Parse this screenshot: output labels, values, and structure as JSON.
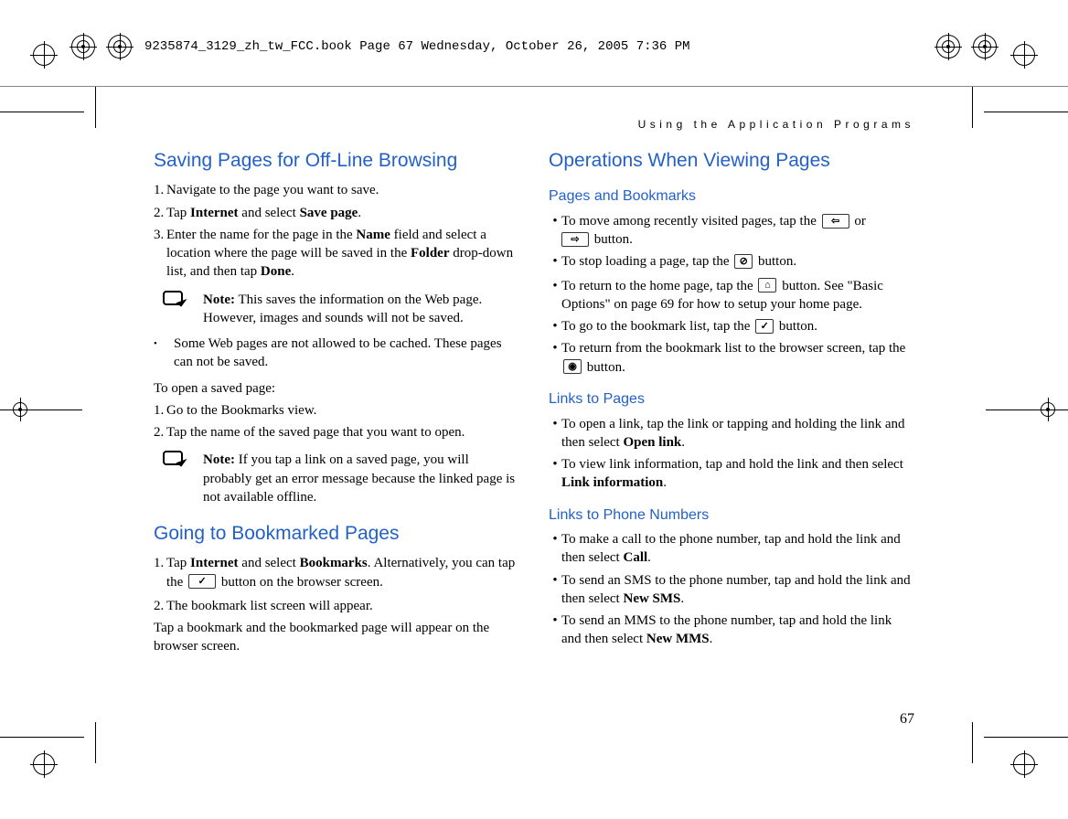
{
  "header_line": "9235874_3129_zh_tw_FCC.book  Page 67  Wednesday, October 26, 2005  7:36 PM",
  "running_head": "Using the Application Programs",
  "page_number": "67",
  "left": {
    "h2_saving": "Saving Pages for Off-Line Browsing",
    "step1": "Navigate to the page you want to save.",
    "step2_a": "Tap ",
    "step2_b": " and select ",
    "step2_c": ".",
    "internet": "Internet",
    "savepage": "Save page",
    "step3_a": "Enter the name for the page in the ",
    "step3_b": " field and select a location where the page will be saved in the ",
    "step3_c": " drop-down list, and then tap ",
    "step3_d": ".",
    "name": "Name",
    "folder": "Folder",
    "done": "Done",
    "note1_lead": "Note:",
    "note1_body": " This saves the information on the Web page. However, images and sounds will not be saved.",
    "bullet1": "Some Web pages are not allowed to be cached. These pages can not be saved.",
    "open_intro": "To open a saved page:",
    "open_step1": "Go to the Bookmarks view.",
    "open_step2": "Tap the name of the saved page that you want to open.",
    "note2_lead": "Note:",
    "note2_body": " If you tap a link on a saved page, you will probably get an error message because the linked page is not available offline.",
    "h2_going": "Going to Bookmarked Pages",
    "going_step1_a": "Tap ",
    "going_step1_b": " and select ",
    "going_step1_c": ". Alternatively, you can tap the ",
    "going_step1_d": " button on the browser screen.",
    "bookmarks": "Bookmarks",
    "going_step2": "The bookmark list screen will appear.",
    "going_outro": "Tap a bookmark and the bookmarked page will appear on the browser screen."
  },
  "right": {
    "h2_ops": "Operations When Viewing Pages",
    "h3_pages": "Pages and Bookmarks",
    "pb1_a": "To move among recently visited pages, tap the ",
    "pb1_b": " or ",
    "pb1_c": " button.",
    "pb2_a": "To stop loading a page, tap the ",
    "pb2_b": " button.",
    "pb3_a": "To return to the home page, tap the ",
    "pb3_b": " button. See \"Basic Options\" on page 69 for how to setup your home page.",
    "pb4_a": "To go to the bookmark list, tap the ",
    "pb4_b": " button.",
    "pb5_a": "To return from the bookmark list to the browser screen, tap the ",
    "pb5_b": " button.",
    "h3_links": "Links to Pages",
    "lp1_a": "To open a link, tap the link or tapping and holding the link and then select ",
    "lp1_b": ".",
    "openlink": "Open link",
    "lp2_a": "To view link information, tap and hold the link and then select ",
    "lp2_b": ".",
    "linkinfo": "Link information",
    "h3_phone": "Links to Phone Numbers",
    "ph1_a": "To make a call to the phone number, tap and hold the link and then select ",
    "ph1_b": ".",
    "call": "Call",
    "ph2_a": "To send an SMS to the phone number, tap and hold the link and then select ",
    "ph2_b": ".",
    "newsms": "New SMS",
    "ph3_a": "To send an MMS to the phone number, tap and hold the link and then select ",
    "ph3_b": ".",
    "newmms": "New MMS"
  },
  "icons": {
    "back": "⇦",
    "forward": "⇨",
    "stop": "⊘",
    "home": "⌂",
    "bookmark": "✓",
    "browser": "◉"
  }
}
